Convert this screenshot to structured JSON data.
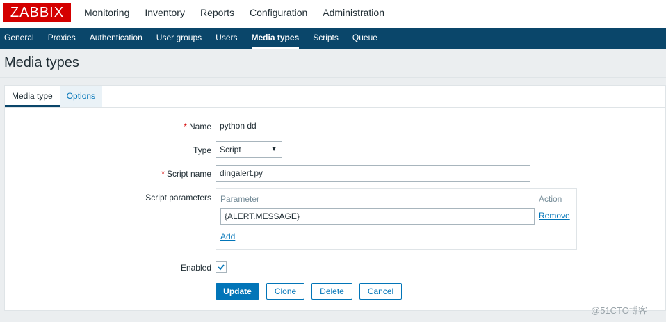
{
  "logo": "ZABBIX",
  "main_menu": [
    "Monitoring",
    "Inventory",
    "Reports",
    "Configuration",
    "Administration"
  ],
  "sub_menu": [
    "General",
    "Proxies",
    "Authentication",
    "User groups",
    "Users",
    "Media types",
    "Scripts",
    "Queue"
  ],
  "page_title": "Media types",
  "tabs": [
    "Media type",
    "Options"
  ],
  "form": {
    "name_label": "Name",
    "name_value": "python dd",
    "type_label": "Type",
    "type_value": "Script",
    "script_name_label": "Script name",
    "script_name_value": "dingalert.py",
    "script_params_label": "Script parameters",
    "param_col_header": "Parameter",
    "action_col_header": "Action",
    "param_value": "{ALERT.MESSAGE}",
    "remove_label": "Remove",
    "add_label": "Add",
    "enabled_label": "Enabled",
    "enabled": true
  },
  "buttons": {
    "update": "Update",
    "clone": "Clone",
    "delete": "Delete",
    "cancel": "Cancel"
  },
  "watermark": "@51CTO博客",
  "colors": {
    "brand_red": "#d40000",
    "nav_blue": "#0a466a",
    "link_blue": "#0275b8"
  }
}
